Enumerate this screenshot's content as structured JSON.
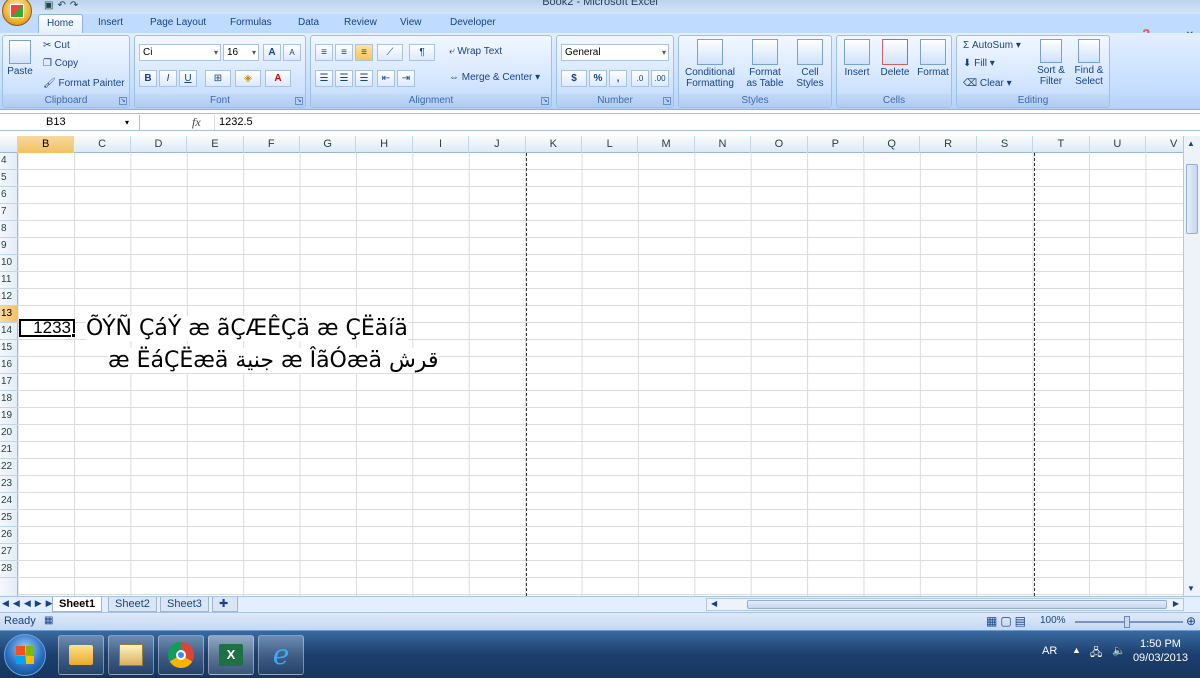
{
  "window": {
    "title": "Book2 - Microsoft Excel"
  },
  "tabs": [
    "Home",
    "Insert",
    "Page Layout",
    "Formulas",
    "Data",
    "Review",
    "View",
    "Developer"
  ],
  "ribbon": {
    "clipboard": {
      "paste": "Paste",
      "cut": "Cut",
      "copy": "Copy",
      "format_painter": "Format Painter",
      "label": "Clipboard"
    },
    "font": {
      "name": "Ci",
      "size": "16",
      "bold": "B",
      "italic": "I",
      "underline": "U",
      "grow": "A",
      "shrink": "A",
      "label": "Font"
    },
    "alignment": {
      "wrap": "Wrap Text",
      "merge": "Merge & Center",
      "label": "Alignment"
    },
    "number": {
      "format": "General",
      "currency": "$",
      "percent": "%",
      "comma": ",",
      "inc": ".0",
      "dec": ".00",
      "label": "Number"
    },
    "styles": {
      "conditional": "Conditional",
      "conditional2": "Formatting",
      "format_as": "Format",
      "format_as2": "as Table",
      "cell": "Cell",
      "cell2": "Styles",
      "label": "Styles"
    },
    "cells": {
      "insert": "Insert",
      "delete": "Delete",
      "format": "Format",
      "label": "Cells"
    },
    "editing": {
      "autosum": "AutoSum",
      "fill": "Fill",
      "clear": "Clear",
      "sort": "Sort &",
      "sort2": "Filter",
      "find": "Find &",
      "find2": "Select",
      "label": "Editing"
    }
  },
  "formula_bar": {
    "name_box": "B13",
    "fx": "fx",
    "value": "1232.5"
  },
  "columns": [
    "B",
    "C",
    "D",
    "E",
    "F",
    "G",
    "H",
    "I",
    "J",
    "K",
    "L",
    "M",
    "N",
    "O",
    "P",
    "Q",
    "R",
    "S",
    "T",
    "U",
    "V"
  ],
  "rows": [
    "4",
    "5",
    "6",
    "7",
    "8",
    "9",
    "10",
    "11",
    "12",
    "13",
    "14",
    "15",
    "16",
    "17",
    "18",
    "19",
    "20",
    "21",
    "22",
    "23",
    "24",
    "25",
    "26",
    "27",
    "28"
  ],
  "active_cell": {
    "display": "1233"
  },
  "cell_text": {
    "line1": "ÕÝÑ  ÇáÝ æ  ãÇÆÊÇä  æ ÇËäíä",
    "line2": "æ ËáÇËæä  جنية æ  ÎãÓæä قرش"
  },
  "sheets": [
    "Sheet1",
    "Sheet2",
    "Sheet3"
  ],
  "status": {
    "ready": "Ready",
    "zoom": "100%"
  },
  "taskbar": {
    "lang": "AR",
    "time": "1:50 PM",
    "date": "09/03/2013"
  }
}
